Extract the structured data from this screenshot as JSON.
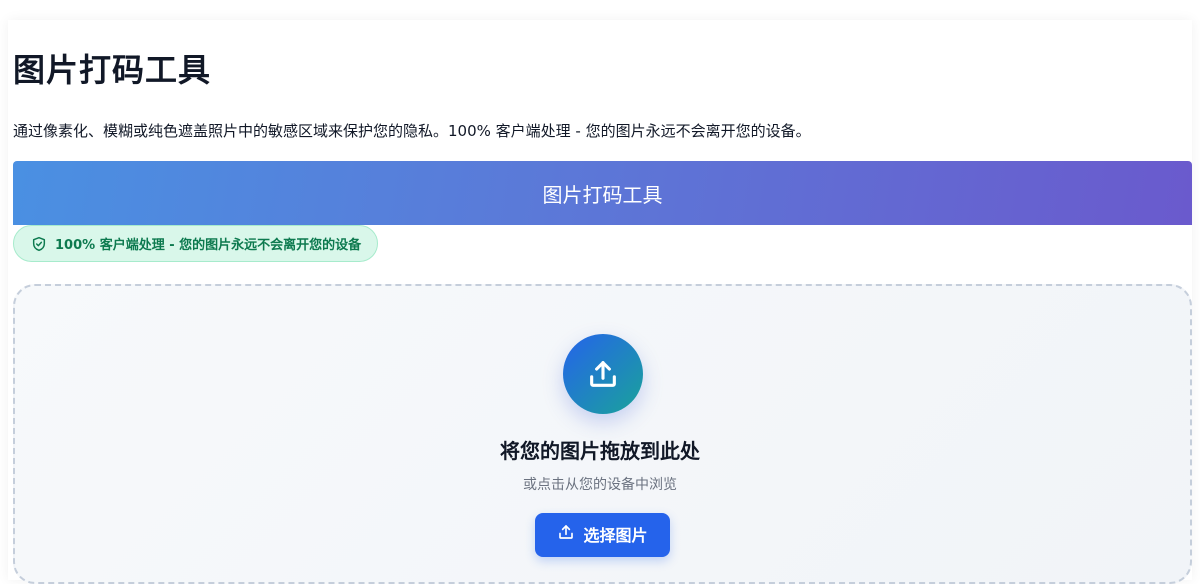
{
  "page": {
    "title": "图片打码工具",
    "description": "通过像素化、模糊或纯色遮盖照片中的敏感区域来保护您的隐私。100% 客户端处理 - 您的图片永远不会离开您的设备。"
  },
  "tool": {
    "header_title": "图片打码工具",
    "privacy_badge": "100% 客户端处理 - 您的图片永远不会离开您的设备",
    "privacy_icon": "shield-check-icon"
  },
  "dropzone": {
    "icon": "upload-icon",
    "title": "将您的图片拖放到此处",
    "subtitle": "或点击从您的设备中浏览",
    "button_label": "选择图片",
    "button_icon": "upload-icon"
  },
  "colors": {
    "header_gradient_start": "#4a90e2",
    "header_gradient_end": "#6a5acd",
    "badge_bg": "#d9f7ea",
    "badge_text": "#0d7a4f",
    "primary": "#2563eb"
  }
}
